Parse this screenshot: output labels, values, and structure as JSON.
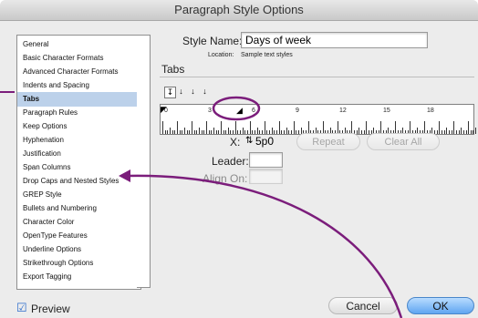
{
  "window": {
    "title": "Paragraph Style Options"
  },
  "sidebar": {
    "items": [
      {
        "label": "General"
      },
      {
        "label": "Basic Character Formats"
      },
      {
        "label": "Advanced Character Formats"
      },
      {
        "label": "Indents and Spacing"
      },
      {
        "label": "Tabs"
      },
      {
        "label": "Paragraph Rules"
      },
      {
        "label": "Keep Options"
      },
      {
        "label": "Hyphenation"
      },
      {
        "label": "Justification"
      },
      {
        "label": "Span Columns"
      },
      {
        "label": "Drop Caps and Nested Styles"
      },
      {
        "label": "GREP Style"
      },
      {
        "label": "Bullets and Numbering"
      },
      {
        "label": "Character Color"
      },
      {
        "label": "OpenType Features"
      },
      {
        "label": "Underline Options"
      },
      {
        "label": "Strikethrough Options"
      },
      {
        "label": "Export Tagging"
      }
    ],
    "selected": "Tabs"
  },
  "style_name": {
    "label": "Style Name:",
    "value": "Days of week"
  },
  "location": {
    "label": "Location:",
    "value": "Sample text styles"
  },
  "section": {
    "title": "Tabs"
  },
  "tab_alignment_buttons": [
    {
      "glyph": "↧",
      "icon": "left-justified-tab-icon"
    },
    {
      "glyph": "↓",
      "icon": "center-justified-tab-icon"
    },
    {
      "glyph": "↓",
      "icon": "right-justified-tab-icon"
    },
    {
      "glyph": "↓",
      "icon": "align-to-decimal-tab-icon"
    }
  ],
  "ruler": {
    "labels": [
      "0",
      "3",
      "6",
      "9",
      "12",
      "15",
      "18"
    ]
  },
  "fields": {
    "x_label": "X:",
    "x_value": "5p0",
    "leader_label": "Leader:",
    "leader_value": "",
    "align_on_label": "Align On:",
    "align_on_value": ""
  },
  "buttons": {
    "repeat": "Repeat",
    "clear_all": "Clear All",
    "cancel": "Cancel",
    "ok": "OK"
  },
  "preview": {
    "label": "Preview",
    "checked": true
  },
  "colors": {
    "annotation": "#7b1d7b",
    "selection": "#bcd1ea",
    "ok_button": "#5fa5f1"
  }
}
